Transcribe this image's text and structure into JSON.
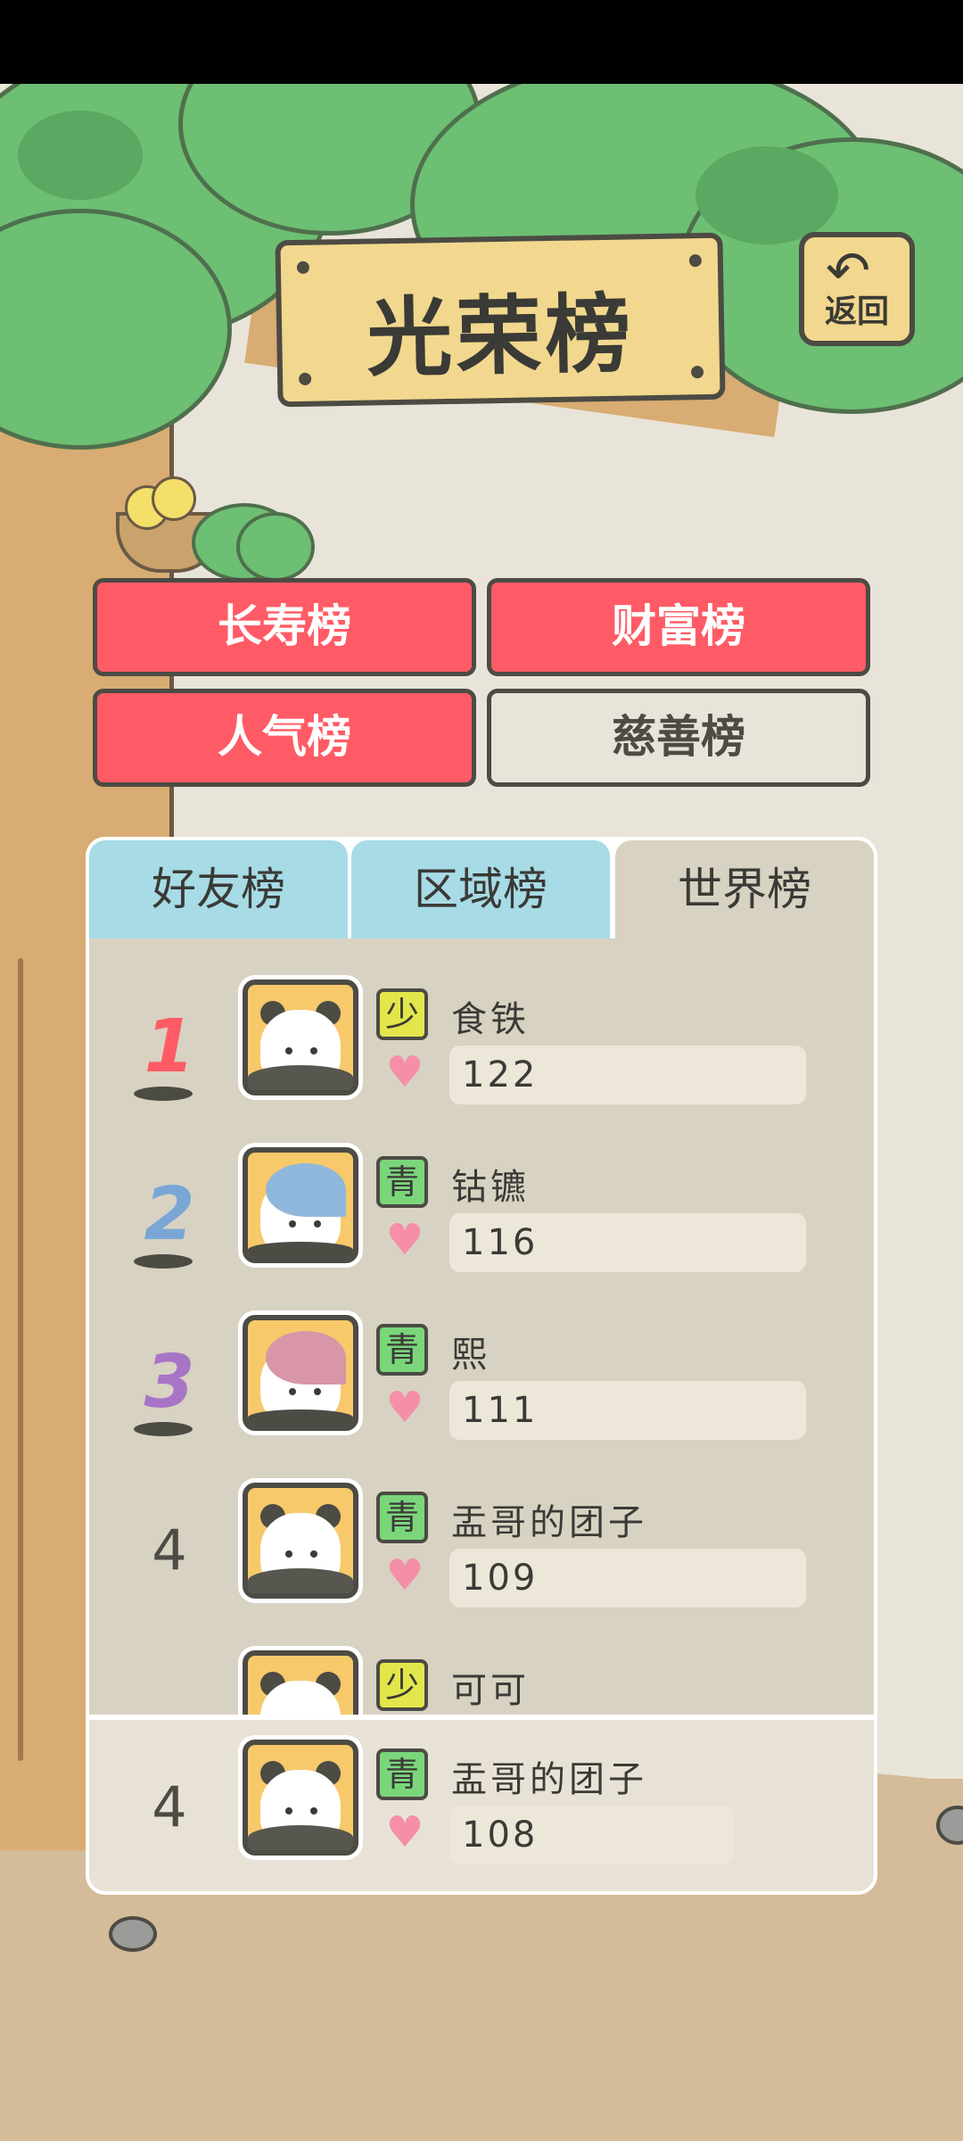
{
  "title": "光荣榜",
  "back": {
    "label": "返回",
    "icon": "return-arrow-icon"
  },
  "categories": [
    {
      "label": "长寿榜",
      "active": true
    },
    {
      "label": "财富榜",
      "active": true
    },
    {
      "label": "人气榜",
      "active": true
    },
    {
      "label": "慈善榜",
      "active": false
    }
  ],
  "tabs": [
    {
      "label": "好友榜",
      "selected": false
    },
    {
      "label": "区域榜",
      "selected": false
    },
    {
      "label": "世界榜",
      "selected": true
    }
  ],
  "rows": [
    {
      "rank": "1",
      "stage": "少",
      "name": "食铁",
      "score": "122",
      "avatar": "panda-avatar"
    },
    {
      "rank": "2",
      "stage": "青",
      "name": "钴镳",
      "score": "116",
      "avatar": "blue-fin-avatar"
    },
    {
      "rank": "3",
      "stage": "青",
      "name": "熙",
      "score": "111",
      "avatar": "pink-fin-avatar"
    },
    {
      "rank": "4",
      "stage": "青",
      "name": "盂哥的团子",
      "score": "109",
      "avatar": "panda-avatar"
    },
    {
      "rank": "",
      "stage": "少",
      "name": "可可",
      "score": "",
      "avatar": "panda-avatar"
    }
  ],
  "me": {
    "rank": "4",
    "stage": "青",
    "name": "盂哥的团子",
    "score": "108",
    "avatar": "panda-avatar"
  },
  "colors": {
    "rank1": "#ff5b66",
    "rank2": "#7aa6d6",
    "rank3": "#a874c6",
    "tab_active": "#d8d2c2",
    "tab_inactive": "#a7dbe6",
    "category_red": "#ff5b66"
  }
}
